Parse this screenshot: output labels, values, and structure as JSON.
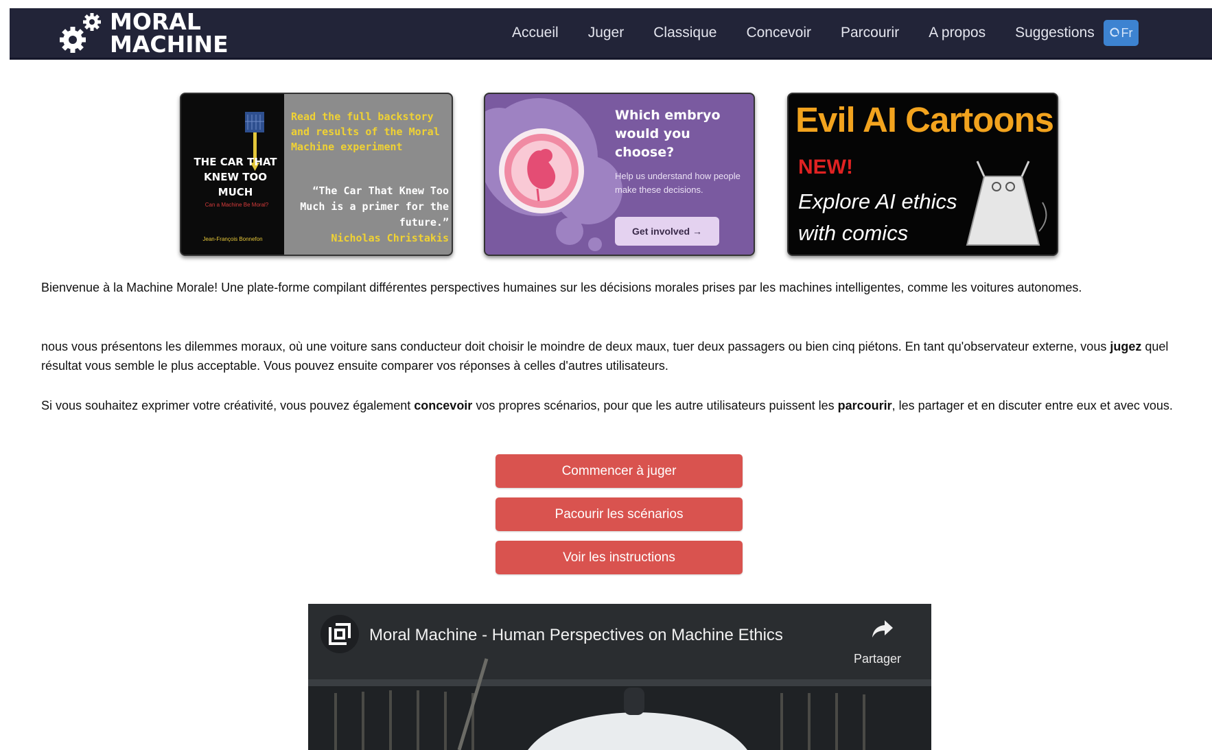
{
  "header": {
    "logo_line1": "MORAL",
    "logo_line2": "MACHINE",
    "nav": [
      "Accueil",
      "Juger",
      "Classique",
      "Concevoir",
      "Parcourir",
      "A propos",
      "Suggestions"
    ],
    "lang_label": "Fr"
  },
  "banners": {
    "book": {
      "cover_title": "THE CAR THAT KNEW TOO MUCH",
      "cover_subtitle": "Can a Machine Be Moral?",
      "cover_author": "Jean-François Bonnefon",
      "story": "Read the full backstory and results of the Moral Machine experiment",
      "quote": "“The Car That Knew Too Much is a primer for the future.”",
      "quote_author": "Nicholas Christakis"
    },
    "embryo": {
      "title": "Which embryo would you choose?",
      "text": "Help us understand how people make these decisions.",
      "button": "Get involved →"
    },
    "cartoons": {
      "title": "Evil AI Cartoons",
      "new_label": "NEW!",
      "subtitle_line1": "Explore AI ethics",
      "subtitle_line2": "with comics"
    }
  },
  "content": {
    "p1": "Bienvenue à la Machine Morale! Une plate-forme compilant différentes perspectives humaines sur les décisions morales prises par les machines intelligentes, comme les voitures autonomes.",
    "p2_a": "nous vous présentons les dilemmes moraux, où une voiture sans conducteur doit choisir le moindre de deux maux, tuer deux passagers ou bien cinq piétons. En tant qu'observateur externe, vous ",
    "p2_b": "jugez",
    "p2_c": " quel résultat vous semble le plus acceptable. Vous pouvez ensuite comparer vos réponses à celles d'autres utilisateurs.",
    "p3_a": "Si vous souhaitez exprimer votre créativité, vous pouvez également ",
    "p3_b": "concevoir",
    "p3_c": " vos propres scénarios, pour que les autre utilisateurs puissent les ",
    "p3_d": "parcourir",
    "p3_e": ", les partager et en discuter entre eux et avec vous."
  },
  "buttons": {
    "start": "Commencer à juger",
    "browse": "Pacourir les scénarios",
    "instructions": "Voir les instructions"
  },
  "video": {
    "title": "Moral Machine - Human Perspectives on Machine Ethics",
    "share": "Partager"
  },
  "colors": {
    "navbar": "#222438",
    "lang_button": "#3d83d1",
    "action_button": "#d9534f",
    "embryo_banner": "#7a5aa0",
    "cartoon_title": "#f2a31e",
    "cartoon_new": "#e02222",
    "book_accent": "#f0d233"
  }
}
